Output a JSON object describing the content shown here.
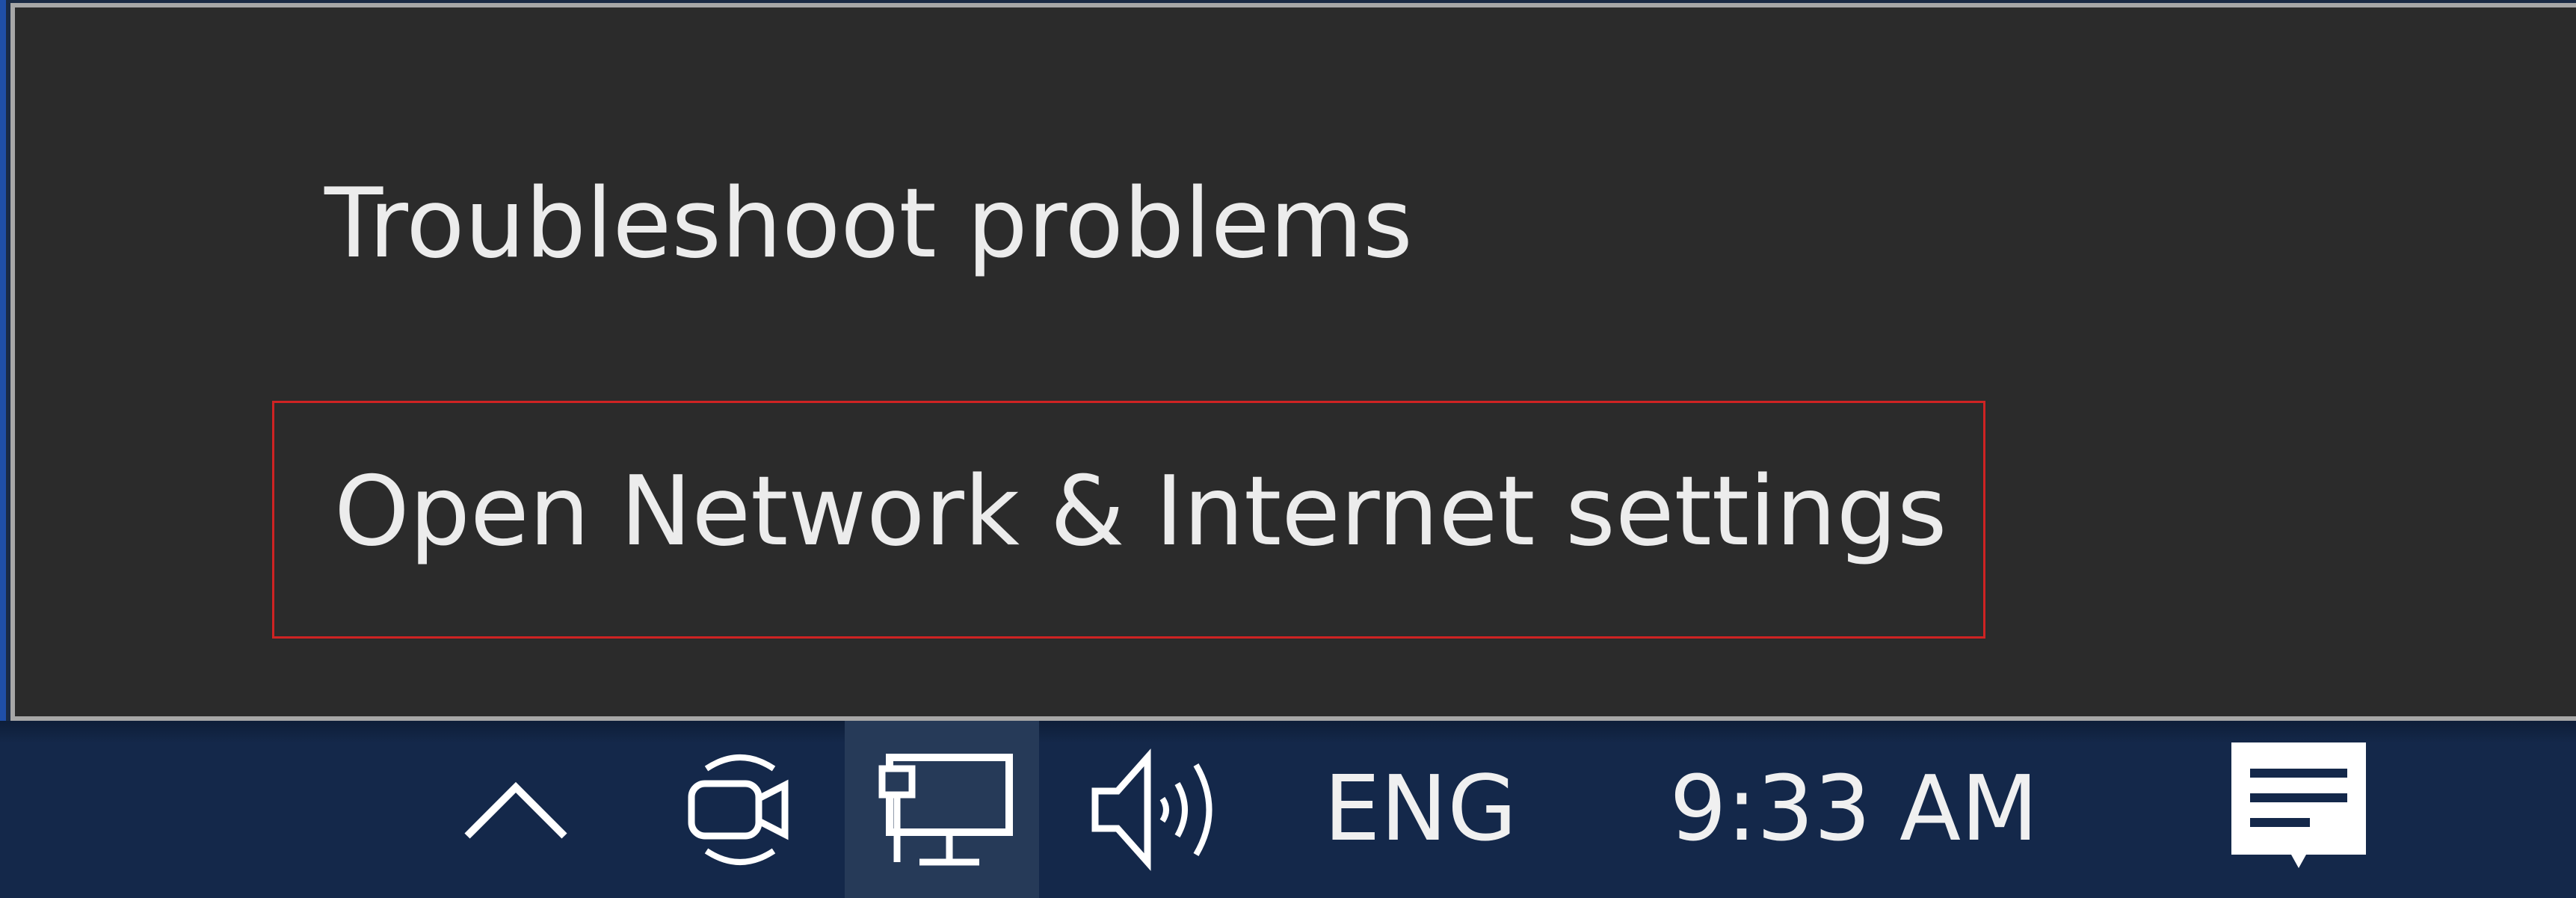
{
  "context_menu": {
    "items": [
      {
        "label": "Troubleshoot problems"
      },
      {
        "label": "Open Network & Internet settings",
        "highlighted": true
      }
    ]
  },
  "taskbar": {
    "tray_icons": [
      {
        "icon": "chevron-up-icon"
      },
      {
        "icon": "meet-now-icon"
      },
      {
        "icon": "network-ethernet-icon",
        "active": true
      },
      {
        "icon": "volume-icon"
      }
    ],
    "language": "ENG",
    "clock": "9:33 AM",
    "notification_icon": "action-center-icon"
  },
  "colors": {
    "menu_background": "#2b2b2b",
    "menu_border": "#a7a7a7",
    "highlight_border": "#cf2323",
    "taskbar_background": "#14284a",
    "text": "#ececec"
  }
}
